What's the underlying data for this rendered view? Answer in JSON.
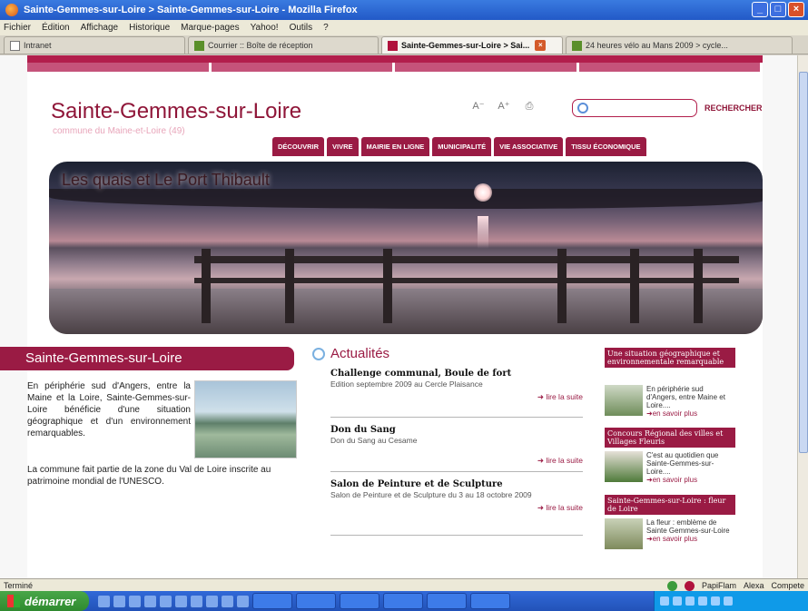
{
  "window": {
    "title": "Sainte-Gemmes-sur-Loire > Sainte-Gemmes-sur-Loire - Mozilla Firefox"
  },
  "menu": [
    "Fichier",
    "Édition",
    "Affichage",
    "Historique",
    "Marque-pages",
    "Yahoo!",
    "Outils",
    "?"
  ],
  "tabs": [
    {
      "label": "Intranet"
    },
    {
      "label": "Courrier :: Boîte de réception"
    },
    {
      "label": "Sainte-Gemmes-sur-Loire > Sai..."
    },
    {
      "label": "24 heures vélo au Mans 2009 > cycle..."
    }
  ],
  "site": {
    "title": "Sainte-Gemmes-sur-Loire",
    "subtitle": "commune du Maine-et-Loire (49)",
    "search_button": "RECHERCHER",
    "nav": [
      "DÉCOUVRIR",
      "VIVRE",
      "MAIRIE EN LIGNE",
      "MUNICIPALITÉ",
      "VIE ASSOCIATIVE",
      "TISSU ÉCONOMIQUE"
    ],
    "hero_caption": "Les quais et Le Port Thibault"
  },
  "intro": {
    "heading": "Sainte-Gemmes-sur-Loire",
    "paragraph_a": "En périphérie sud d'Angers, entre la Maine et la Loire, Sainte-Gemmes-sur-Loire bénéficie d'une situation géographique et d'un environnement remarquables.",
    "paragraph_b": "La commune fait partie de la zone du Val de Loire inscrite au patrimoine mondial de l'UNESCO."
  },
  "news": {
    "heading": "Actualités",
    "read_more": "➜ lire la suite",
    "items": [
      {
        "title": "Challenge communal, Boule de fort",
        "desc": "Edition septembre 2009 au Cercle Plaisance"
      },
      {
        "title": "Don du Sang",
        "desc": "Don du Sang au Cesame"
      },
      {
        "title": "Salon de Peinture et de Sculpture",
        "desc": "Salon de Peinture et de Sculpture du 3 au 18 octobre 2009"
      }
    ]
  },
  "sidebar": {
    "more": "➜en savoir plus",
    "blocks": [
      {
        "heading": "Une situation géographique et environnementale remarquable",
        "text": "En périphérie sud d'Angers, entre Maine et Loire...."
      },
      {
        "heading": "Concours Régional des villes et Villages Fleuris",
        "text": "C'est au quotidien que Sainte-Gemmes-sur-Loire...."
      },
      {
        "heading": "Sainte-Gemmes-sur-Loire : fleur de Loire",
        "text": "La fleur : emblème de Sainte Gemmes-sur-Loire"
      }
    ]
  },
  "status": {
    "left": "Terminé",
    "right_items": [
      "PapiFlam",
      "Alexa",
      "Compete"
    ]
  },
  "taskbar": {
    "start_label": "démarrer"
  }
}
